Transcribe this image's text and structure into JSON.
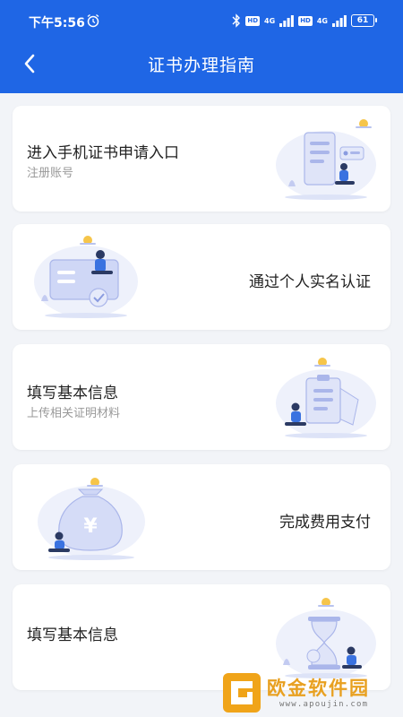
{
  "status": {
    "time": "下午5:56",
    "hd1": "HD",
    "net1": "4G",
    "hd2": "HD",
    "net2": "4G",
    "battery": "61"
  },
  "header": {
    "title": "证书办理指南"
  },
  "cards": [
    {
      "title": "进入手机证书申请入口",
      "subtitle": "注册账号",
      "illustration": "phone-registration-icon"
    },
    {
      "title": "通过个人实名认证",
      "subtitle": "",
      "illustration": "id-card-verification-icon"
    },
    {
      "title": "填写基本信息",
      "subtitle": "上传相关证明材料",
      "illustration": "clipboard-form-icon"
    },
    {
      "title": "完成费用支付",
      "subtitle": "",
      "illustration": "money-bag-icon"
    },
    {
      "title": "填写基本信息",
      "subtitle": "",
      "illustration": "hourglass-icon"
    }
  ],
  "watermark": {
    "text": "欧金软件园",
    "url": "www.apoujin.com"
  },
  "colors": {
    "header": "#1f66e5",
    "background": "#f2f4f8",
    "card": "#ffffff",
    "accent": "#f6c54a",
    "illustration": "#a8b4ec"
  }
}
